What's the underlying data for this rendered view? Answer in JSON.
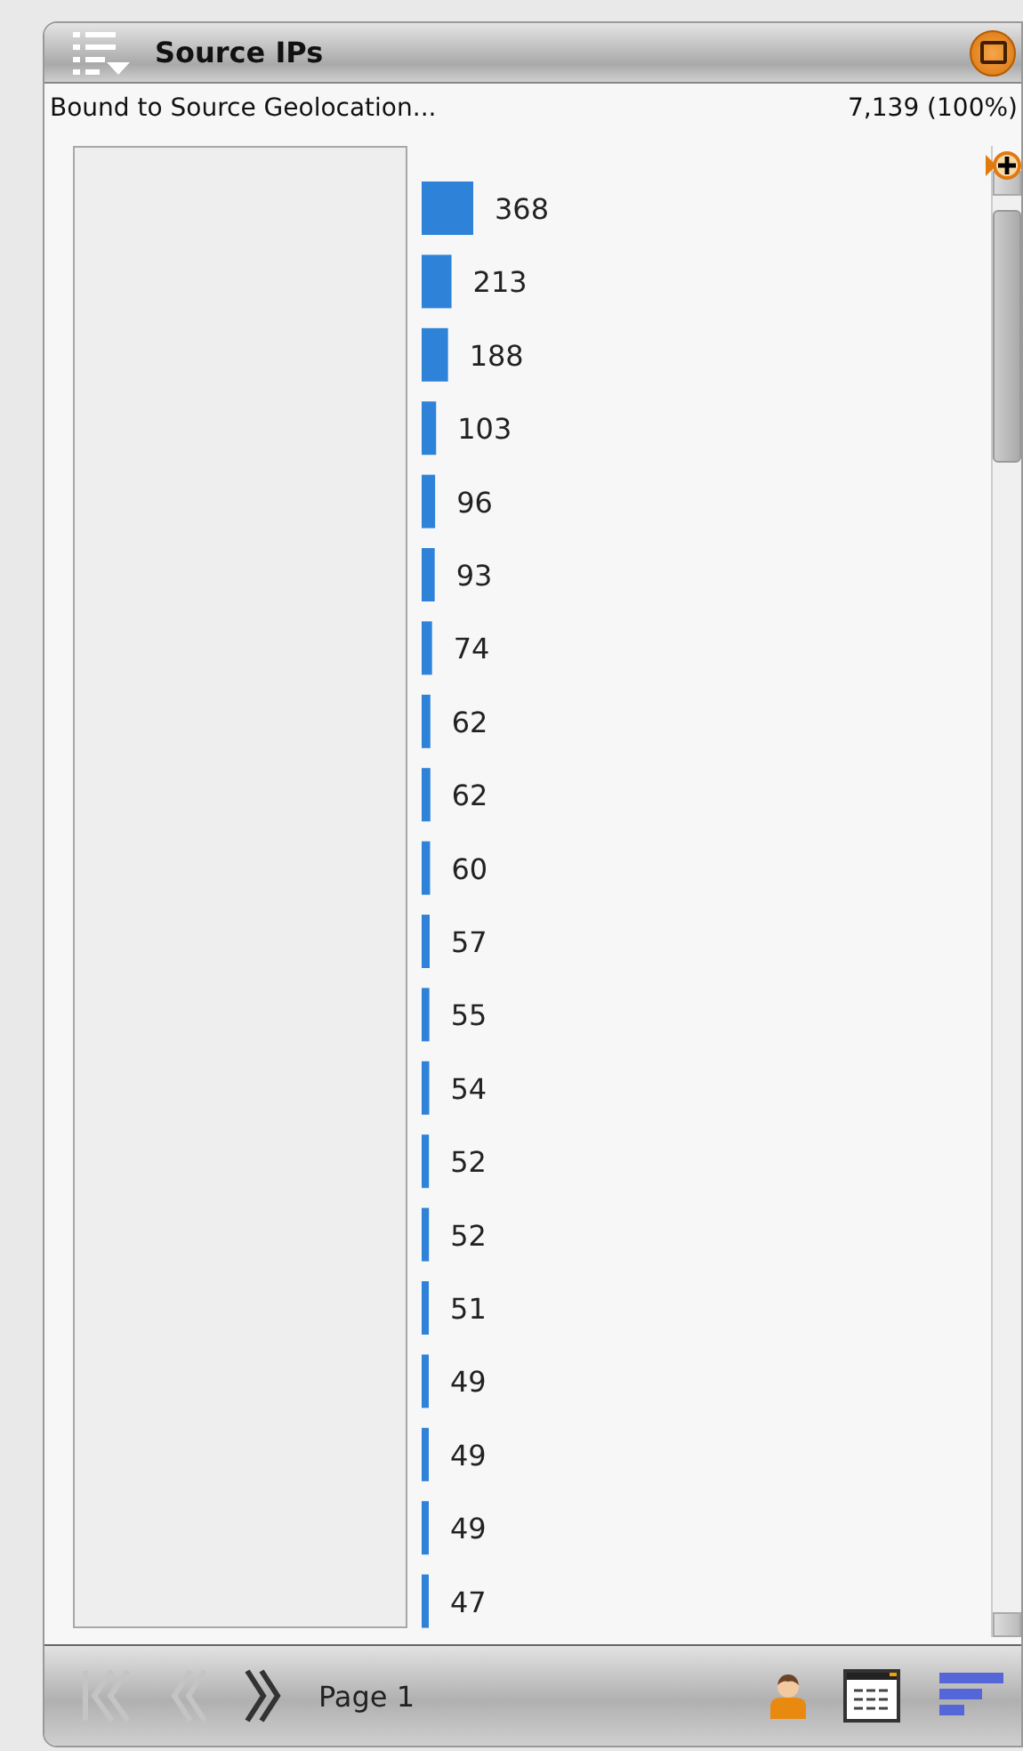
{
  "panel": {
    "title": "Source IPs"
  },
  "summary": {
    "label": "Bound to Source Geolocation...",
    "total": "7,139 (100%)"
  },
  "chart": {
    "chart_data": {
      "type": "bar",
      "orientation": "horizontal",
      "data_labels": true,
      "series": [
        {
          "color": "#2e82d8",
          "values": [
            368,
            213,
            188,
            103,
            96,
            93,
            74,
            62,
            62,
            60,
            57,
            55,
            54,
            52,
            52,
            51,
            49,
            49,
            49,
            47
          ]
        }
      ]
    }
  },
  "pager": {
    "buttons": [
      {
        "kind": "first",
        "disabled": true
      },
      {
        "kind": "previous",
        "disabled": true
      },
      {
        "kind": "next",
        "disabled": false
      }
    ],
    "page": "Page 1"
  }
}
